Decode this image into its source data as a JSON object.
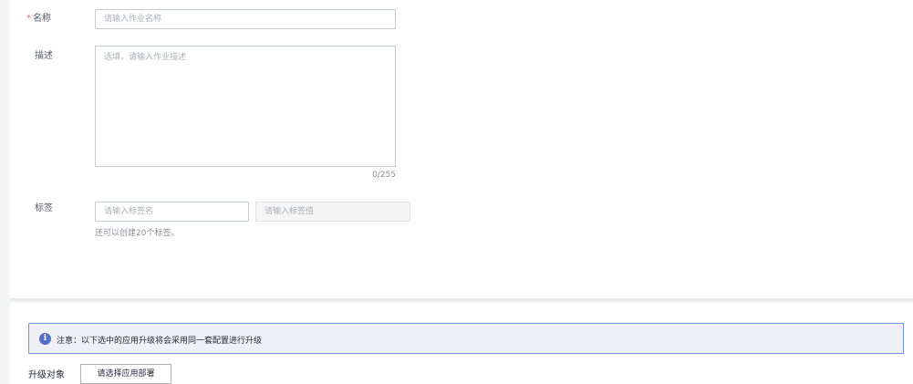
{
  "form": {
    "name": {
      "required_mark": "*",
      "label": "名称",
      "placeholder": "请输入作业名称"
    },
    "description": {
      "label": "描述",
      "placeholder": "选填，请输入作业描述",
      "counter": "0/255"
    },
    "tags": {
      "label": "标签",
      "key_placeholder": "请输入标签名",
      "value_placeholder": "请输入标签值",
      "hint": "还可以创建20个标签。"
    }
  },
  "upgrade": {
    "notice_icon": "info-icon",
    "notice_icon_glyph": "i",
    "notice_text": "注意：以下选中的应用升级将会采用同一套配置进行升级",
    "target_label": "升级对象",
    "select_button_label": "请选择应用部署"
  },
  "colors": {
    "required": "#f66f6a",
    "notice_border": "#7693f5",
    "notice_icon": "#526ecc"
  }
}
